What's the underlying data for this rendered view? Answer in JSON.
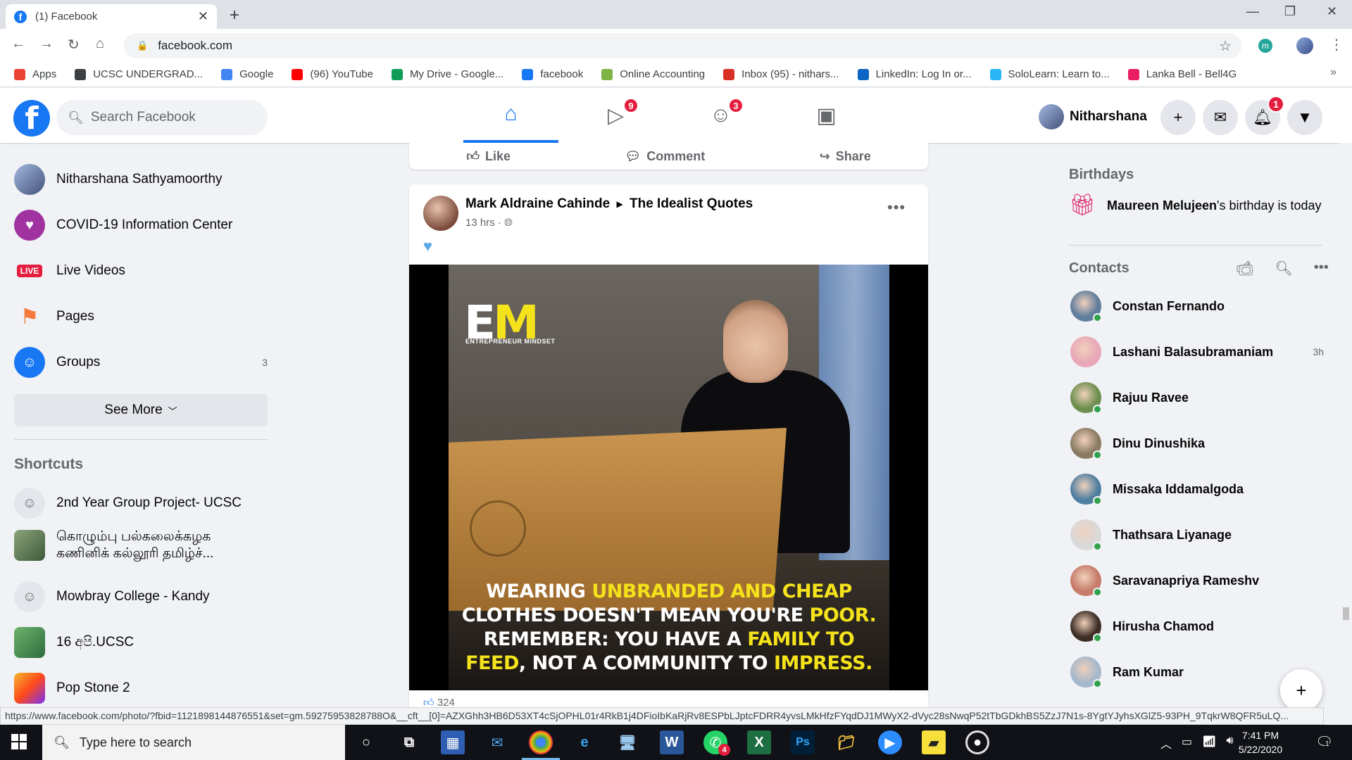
{
  "browser": {
    "tab_title": "(1) Facebook",
    "url": "facebook.com",
    "bookmarks": [
      {
        "label": "Apps",
        "icon": "apps-grid-icon",
        "color": "#ea4335"
      },
      {
        "label": "UCSC UNDERGRAD...",
        "icon": "globe-icon",
        "color": "#3c4043"
      },
      {
        "label": "Google",
        "icon": "google-g-icon",
        "color": "#4285f4"
      },
      {
        "label": "(96) YouTube",
        "icon": "youtube-icon",
        "color": "#ff0000"
      },
      {
        "label": "My Drive - Google...",
        "icon": "drive-icon",
        "color": "#0f9d58"
      },
      {
        "label": "facebook",
        "icon": "facebook-icon",
        "color": "#1877f2"
      },
      {
        "label": "Online Accounting",
        "icon": "accounting-icon",
        "color": "#7cb342"
      },
      {
        "label": "Inbox (95) - nithars...",
        "icon": "gmail-icon",
        "color": "#d93025"
      },
      {
        "label": "LinkedIn: Log In or...",
        "icon": "linkedin-icon",
        "color": "#0a66c2"
      },
      {
        "label": "SoloLearn: Learn to...",
        "icon": "sololearn-icon",
        "color": "#29b6f6"
      },
      {
        "label": "Lanka Bell - Bell4G",
        "icon": "lankabell-icon",
        "color": "#e91e63"
      }
    ],
    "status_url": "https://www.facebook.com/photo/?fbid=1121898144876551&set=gm.59275953828788O&__cft__[0]=AZXGhh3HB6D53XT4cSjOPHL01r4RkB1j4DFioIbKaRjRv8ESPbLJptcFDRR4yvsLMkHfzFYqdDJ1MWyX2-dVyc28sNwqP52tTbGDkhBS5ZzJ7N1s-8YgtYJyhsXGlZ5-93PH_9TqkrW8QFR5uLQ..."
  },
  "fb": {
    "search_placeholder": "Search Facebook",
    "nav": {
      "watch_badge": "9",
      "groups_badge": "3"
    },
    "user_name": "Nitharshana",
    "notifications_badge": "1"
  },
  "left": {
    "items": [
      {
        "label": "Nitharshana Sathyamoorthy",
        "icon": "profile-avatar"
      },
      {
        "label": "COVID-19 Information Center",
        "icon": "covid-heart-icon"
      },
      {
        "label": "Live Videos",
        "icon": "live-icon",
        "badge": "LIVE"
      },
      {
        "label": "Pages",
        "icon": "flag-icon"
      },
      {
        "label": "Groups",
        "icon": "groups-icon",
        "count": "3"
      }
    ],
    "see_more": "See More",
    "shortcuts_title": "Shortcuts",
    "shortcuts": [
      {
        "label": "2nd Year Group Project- UCSC"
      },
      {
        "label": "கொழும்பு பல்கலைக்கழக\nகணினிக் கல்லூரி தமிழ்ச்..."
      },
      {
        "label": "Mowbray College - Kandy"
      },
      {
        "label": "16 අපි.UCSC"
      },
      {
        "label": "Pop Stone 2"
      }
    ]
  },
  "feed": {
    "prev_actions": {
      "like": "Like",
      "comment": "Comment",
      "share": "Share"
    },
    "post": {
      "author": "Mark Aldraine Cahinde",
      "group": "The Idealist Quotes",
      "time": "13 hrs ·",
      "logo_e": "E",
      "logo_m": "M",
      "logo_sub": "ENTREPRENEUR MINDSET",
      "quote": {
        "l1a": "WEARING ",
        "l1b": "UNBRANDED AND CHEAP",
        "l2a": "CLOTHES DOESN'T MEAN YOU'RE ",
        "l2b": "POOR.",
        "l3a": "REMEMBER: YOU HAVE A ",
        "l3b": "FAMILY TO",
        "l4a": "FEED",
        "l4b": ", NOT A COMMUNITY TO ",
        "l4c": "IMPRESS."
      },
      "reactions_count": "324"
    }
  },
  "right": {
    "birthdays_title": "Birthdays",
    "birthday_name": "Maureen Melujeen",
    "birthday_text": "'s birthday is today",
    "contacts_title": "Contacts",
    "contacts": [
      {
        "name": "Constan Fernando",
        "online": true,
        "meta": ""
      },
      {
        "name": "Lashani Balasubramaniam",
        "online": false,
        "meta": "3h"
      },
      {
        "name": "Rajuu Ravee",
        "online": true,
        "meta": ""
      },
      {
        "name": "Dinu Dinushika",
        "online": true,
        "meta": ""
      },
      {
        "name": "Missaka Iddamalgoda",
        "online": true,
        "meta": ""
      },
      {
        "name": "Thathsara Liyanage",
        "online": true,
        "meta": ""
      },
      {
        "name": "Saravanapriya Rameshv",
        "online": true,
        "meta": ""
      },
      {
        "name": "Hirusha Chamod",
        "online": true,
        "meta": ""
      },
      {
        "name": "Ram Kumar",
        "online": true,
        "meta": ""
      }
    ]
  },
  "taskbar": {
    "search_placeholder": "Type here to search",
    "time": "7:41 PM",
    "date": "5/22/2020",
    "whatsapp_badge": "4",
    "notification_count": "1"
  }
}
